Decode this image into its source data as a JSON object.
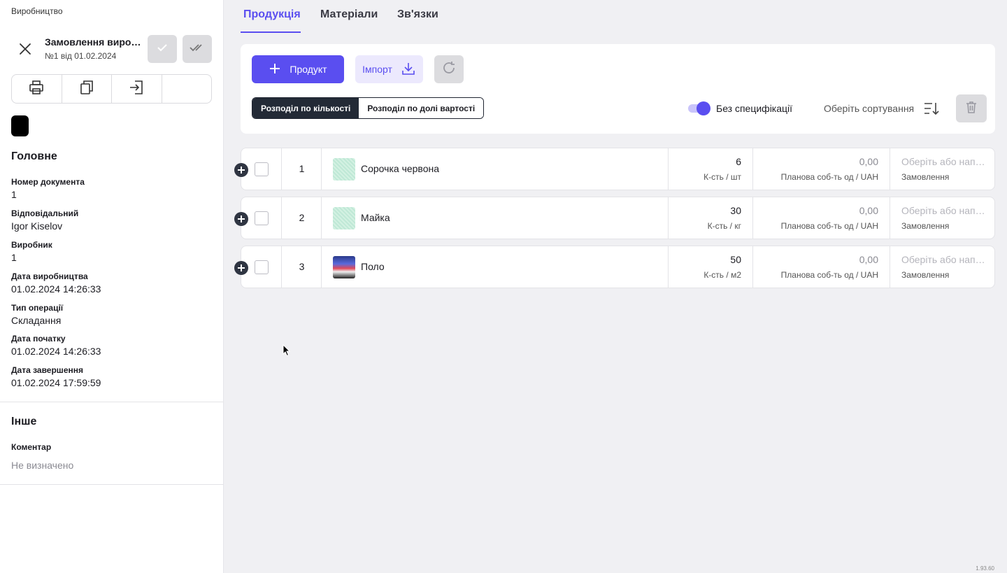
{
  "sidebar": {
    "breadcrumb": "Виробництво",
    "doc_title": "Замовлення виробництва",
    "doc_subtitle": "№1 від 01.02.2024",
    "main_heading": "Головне",
    "fields": [
      {
        "label": "Номер документа",
        "value": "1"
      },
      {
        "label": "Відповідальний",
        "value": "Igor Kiselov"
      },
      {
        "label": "Виробник",
        "value": "1"
      },
      {
        "label": "Дата виробництва",
        "value": "01.02.2024 14:26:33"
      },
      {
        "label": "Тип операції",
        "value": "Складання"
      },
      {
        "label": "Дата початку",
        "value": "01.02.2024 14:26:33"
      },
      {
        "label": "Дата завершення",
        "value": "01.02.2024 17:59:59"
      }
    ],
    "other_heading": "Інше",
    "comment_label": "Коментар",
    "comment_value": "Не визначено"
  },
  "tabs": [
    {
      "label": "Продукція",
      "active": true
    },
    {
      "label": "Матеріали",
      "active": false
    },
    {
      "label": "Зв'язки",
      "active": false
    }
  ],
  "toolbar": {
    "add_product": "Продукт",
    "import": "Імпорт",
    "seg_quantity": "Розподіл по кількості",
    "seg_cost": "Розподіл по долі вартості",
    "toggle_label": "Без специфікації",
    "toggle_on": true,
    "sort_label": "Оберіть сортування"
  },
  "rows": [
    {
      "num": "1",
      "name": "Сорочка червона",
      "qty": "6",
      "qty_unit": "шт",
      "price": "0,00",
      "price_label": "Планова соб-ть од / UAH",
      "order_placeholder": "Оберіть або напишіть",
      "order_label": "Замовлення",
      "thumb": "green"
    },
    {
      "num": "2",
      "name": "Майка",
      "qty": "30",
      "qty_unit": "кг",
      "price": "0,00",
      "price_label": "Планова соб-ть од / UAH",
      "order_placeholder": "Оберіть або напишіть",
      "order_label": "Замовлення",
      "thumb": "green"
    },
    {
      "num": "3",
      "name": "Поло",
      "qty": "50",
      "qty_unit": "м2",
      "price": "0,00",
      "price_label": "Планова соб-ть од / UAH",
      "order_placeholder": "Оберіть або напишіть",
      "order_label": "Замовлення",
      "thumb": "polo"
    }
  ],
  "qty_label_prefix": "К-сть / ",
  "version": "1.93.60",
  "colors": {
    "accent": "#5a4ef0",
    "dark": "#232a36",
    "chip": "#000000"
  }
}
